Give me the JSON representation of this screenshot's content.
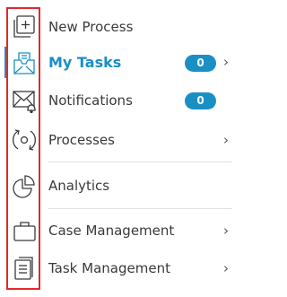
{
  "menu": {
    "items": [
      {
        "label": "New Process",
        "icon": "new-process-icon"
      },
      {
        "label": "My Tasks",
        "icon": "my-tasks-icon",
        "badge": "0",
        "active": true
      },
      {
        "label": "Notifications",
        "icon": "notifications-icon",
        "badge": "0"
      },
      {
        "label": "Processes",
        "icon": "processes-icon"
      },
      {
        "label": "Analytics",
        "icon": "analytics-icon"
      },
      {
        "label": "Case Management",
        "icon": "case-management-icon"
      },
      {
        "label": "Task Management",
        "icon": "task-management-icon"
      }
    ]
  },
  "colors": {
    "accent": "#1a8fc4",
    "highlight_border": "#e0292b",
    "text": "#3a3a3a",
    "divider": "#e2e2e2"
  }
}
